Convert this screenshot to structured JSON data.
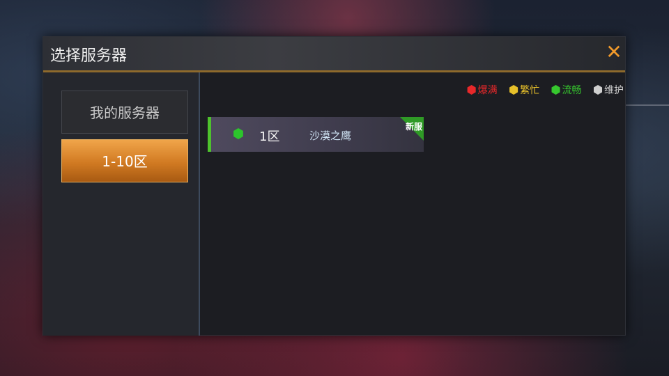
{
  "dialog": {
    "title": "选择服务器",
    "close_label": "✕"
  },
  "sidebar": {
    "items": [
      {
        "label": "我的服务器",
        "active": false
      },
      {
        "label": "1-10区",
        "active": true
      }
    ]
  },
  "legend": [
    {
      "label": "爆满",
      "color": "#e8282a"
    },
    {
      "label": "繁忙",
      "color": "#e7c02a"
    },
    {
      "label": "流畅",
      "color": "#36c72e"
    },
    {
      "label": "维护",
      "color": "#cfcfcf"
    }
  ],
  "servers": [
    {
      "zone": "1区",
      "name": "沙漠之鹰",
      "badge": "新服",
      "status": "流畅",
      "status_color": "#2cc52c"
    }
  ]
}
